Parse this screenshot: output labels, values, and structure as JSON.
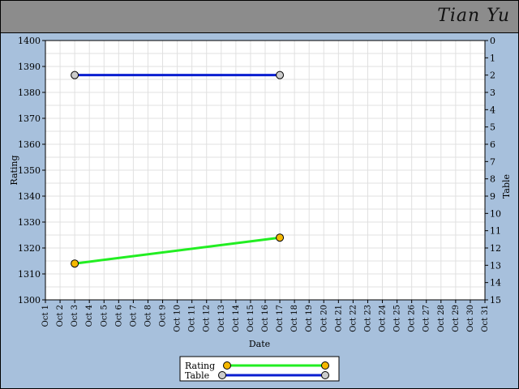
{
  "header": {
    "player_name": "Tian Yu"
  },
  "chart_data": {
    "type": "line",
    "xlabel": "Date",
    "ylabel": "Rating",
    "y2label": "Table",
    "categories": [
      "Oct 1",
      "Oct 2",
      "Oct 3",
      "Oct 4",
      "Oct 5",
      "Oct 6",
      "Oct 7",
      "Oct 8",
      "Oct 9",
      "Oct 10",
      "Oct 11",
      "Oct 12",
      "Oct 13",
      "Oct 14",
      "Oct 15",
      "Oct 16",
      "Oct 17",
      "Oct 18",
      "Oct 19",
      "Oct 20",
      "Oct 21",
      "Oct 22",
      "Oct 23",
      "Oct 24",
      "Oct 25",
      "Oct 26",
      "Oct 27",
      "Oct 28",
      "Oct 29",
      "Oct 30",
      "Oct 31"
    ],
    "ylim": [
      1300,
      1400
    ],
    "yticks": [
      1300,
      1310,
      1320,
      1330,
      1340,
      1350,
      1360,
      1370,
      1380,
      1390,
      1400
    ],
    "y2lim": [
      15,
      0
    ],
    "y2ticks": [
      0,
      1,
      2,
      3,
      4,
      5,
      6,
      7,
      8,
      9,
      10,
      11,
      12,
      13,
      14,
      15
    ],
    "grid": true,
    "legend_position": "bottom-center",
    "series": [
      {
        "name": "Rating",
        "axis": "left",
        "color": "#22ee22",
        "marker_color": "#f5b800",
        "points": [
          [
            "Oct 3",
            1314
          ],
          [
            "Oct 17",
            1324
          ]
        ]
      },
      {
        "name": "Table",
        "axis": "right",
        "color": "#0a1ed0",
        "marker_color": "#cccccc",
        "points": [
          [
            "Oct 3",
            2
          ],
          [
            "Oct 17",
            2
          ]
        ]
      }
    ]
  }
}
